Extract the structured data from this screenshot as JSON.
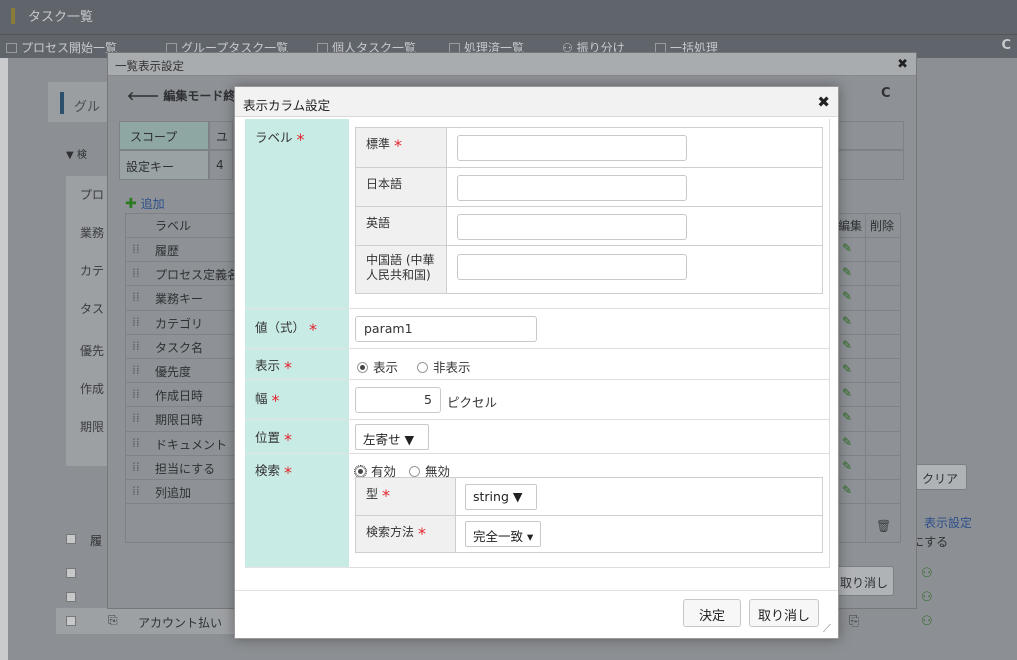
{
  "base": {
    "title": "タスク一覧",
    "menu": [
      {
        "label": "プロセス開始一覧"
      },
      {
        "label": "グループタスク一覧"
      },
      {
        "label": "個人タスク一覧"
      },
      {
        "label": "処理済一覧"
      },
      {
        "label": "振り分け"
      },
      {
        "label": "一括処理"
      }
    ],
    "refresh_icon": "refresh-icon",
    "left_panel": {
      "heading": "グル",
      "search_toggle": "▼ 検",
      "side_labels": [
        "プロ",
        "業務",
        "カテ",
        "タス",
        "優先",
        "作成",
        "期限"
      ],
      "table_head_first": "履",
      "row_text": "アカウント払い"
    },
    "right_panel": {
      "clear_button": "クリア",
      "display_settings_link": "表示設定",
      "ni_suru": "にする",
      "cancel_partial": "取り消し"
    }
  },
  "list_dialog": {
    "title": "一覧表示設定",
    "back_button": "編集モード終了",
    "scope_label": "スコープ",
    "scope_value": "ユ",
    "key_label": "設定キー",
    "key_value": "4",
    "add_label": "追加",
    "columns": {
      "label": "ラベル",
      "edit": "編集",
      "delete": "削除"
    },
    "rows": [
      {
        "label": "履歴"
      },
      {
        "label": "プロセス定義名"
      },
      {
        "label": "業務キー"
      },
      {
        "label": "カテゴリ"
      },
      {
        "label": "タスク名"
      },
      {
        "label": "優先度"
      },
      {
        "label": "作成日時"
      },
      {
        "label": "期限日時"
      },
      {
        "label": "ドキュメント"
      },
      {
        "label": "担当にする"
      },
      {
        "label": "列追加"
      }
    ]
  },
  "column_dialog": {
    "title": "表示カラム設定",
    "label_field": {
      "label": "ラベル",
      "standard_label": "標準",
      "standard_value": "",
      "japanese_label": "日本語",
      "japanese_value": "",
      "english_label": "英語",
      "english_value": "",
      "chinese_label_1": "中国語 (中華",
      "chinese_label_2": "人民共和国)",
      "chinese_value": ""
    },
    "value_field": {
      "label": "値（式）",
      "value": "param1"
    },
    "display_field": {
      "label": "表示",
      "option_show": "表示",
      "option_hide": "非表示",
      "selected": "表示"
    },
    "width_field": {
      "label": "幅",
      "value": "5",
      "unit": "ピクセル"
    },
    "position_field": {
      "label": "位置",
      "selected": "左寄せ ▼"
    },
    "search_field": {
      "label": "検索",
      "option_enabled": "有効",
      "option_disabled": "無効",
      "selected": "有効",
      "type_label": "型",
      "type_value": "string ▼",
      "method_label": "検索方法",
      "method_value": "完全一致 ▾"
    },
    "confirm_button": "決定",
    "cancel_button": "取り消し"
  },
  "colors": {
    "label_bg": "#c9ebe6",
    "required_mark": "#e3232c",
    "add_icon": "#3a8f2e"
  }
}
